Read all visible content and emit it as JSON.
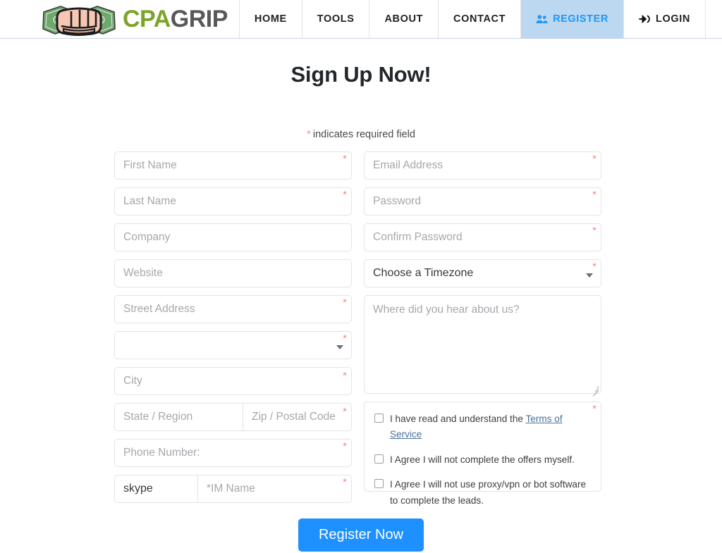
{
  "header": {
    "logo": {
      "icon": "fist-money-icon",
      "text_primary": "CPA",
      "text_secondary": "GRIP",
      "color_primary": "#7ba428",
      "color_secondary": "#58585a"
    },
    "nav": [
      {
        "label": "HOME",
        "icon": null,
        "active": false
      },
      {
        "label": "TOOLS",
        "icon": null,
        "active": false
      },
      {
        "label": "ABOUT",
        "icon": null,
        "active": false
      },
      {
        "label": "CONTACT",
        "icon": null,
        "active": false
      },
      {
        "label": "REGISTER",
        "icon": "users-icon",
        "active": true
      },
      {
        "label": "LOGIN",
        "icon": "sign-in-icon",
        "active": false
      }
    ],
    "active_color": "#2196f3",
    "active_bg": "#bcd7f0"
  },
  "page": {
    "title": "Sign Up Now!",
    "required_note": "indicates required field",
    "required_star": "*",
    "required_star_color": "#f98a85"
  },
  "form": {
    "left": {
      "first_name": {
        "placeholder": "First Name",
        "value": "",
        "required": true
      },
      "last_name": {
        "placeholder": "Last Name",
        "value": "",
        "required": true
      },
      "company": {
        "placeholder": "Company",
        "value": "",
        "required": false
      },
      "website": {
        "placeholder": "Website",
        "value": "",
        "required": false
      },
      "street_address": {
        "placeholder": "Street Address",
        "value": "",
        "required": true
      },
      "country": {
        "placeholder": "",
        "value": "",
        "required": true,
        "type": "select"
      },
      "city": {
        "placeholder": "City",
        "value": "",
        "required": true
      },
      "state": {
        "placeholder": "State / Region",
        "value": "",
        "required": false
      },
      "zip": {
        "placeholder": "Zip / Postal Code",
        "value": "",
        "required": true
      },
      "phone": {
        "placeholder": "Phone Number:",
        "value": "",
        "required": true
      },
      "im_type": {
        "value": "skype",
        "required": false,
        "type": "select"
      },
      "im_name": {
        "placeholder": "*IM Name",
        "value": "",
        "required": true
      }
    },
    "right": {
      "email": {
        "placeholder": "Email Address",
        "value": "",
        "required": true
      },
      "password": {
        "placeholder": "Password",
        "value": "",
        "required": true
      },
      "confirm_password": {
        "placeholder": "Confirm Password",
        "value": "",
        "required": true
      },
      "timezone": {
        "value": "Choose a Timezone",
        "required": true,
        "type": "select"
      },
      "referral": {
        "placeholder": "Where did you hear about us?",
        "value": "",
        "required": false,
        "type": "textarea"
      },
      "agreements": {
        "required": true,
        "items": [
          {
            "text_before": "I have read and understand the ",
            "link_text": "Terms of Service",
            "text_after": "",
            "checked": false
          },
          {
            "text_before": "I Agree I will not complete the offers myself.",
            "link_text": "",
            "text_after": "",
            "checked": false
          },
          {
            "text_before": "I Agree I will not use proxy/vpn or bot software to complete the leads.",
            "link_text": "",
            "text_after": "",
            "checked": false
          }
        ]
      }
    },
    "submit_label": "Register Now",
    "submit_color": "#1e90ff"
  }
}
